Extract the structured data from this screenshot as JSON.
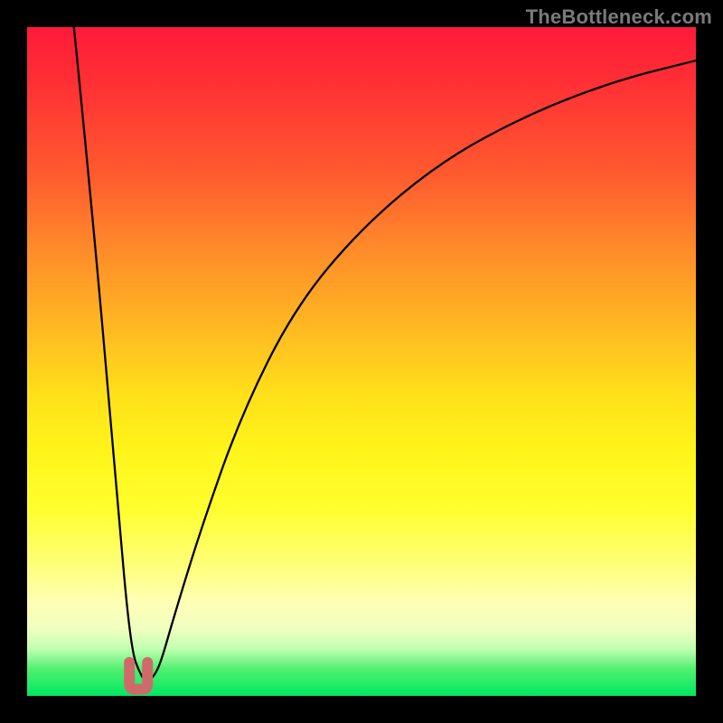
{
  "watermark": "TheBottleneck.com",
  "chart_data": {
    "type": "line",
    "title": "",
    "xlabel": "",
    "ylabel": "",
    "xlim": [
      0,
      100
    ],
    "ylim": [
      0,
      100
    ],
    "series": [
      {
        "name": "bottleneck-curve",
        "x": [
          7,
          10,
          13.5,
          15.5,
          17,
          18,
          19,
          20,
          22,
          26,
          32,
          40,
          50,
          62,
          75,
          88,
          100
        ],
        "values": [
          0,
          30,
          71,
          93,
          97,
          98,
          97,
          95,
          88,
          75,
          58,
          42,
          30,
          20,
          13,
          8,
          5
        ]
      }
    ],
    "marker": {
      "name": "valley-marker",
      "x_range": [
        15.3,
        18.0
      ],
      "y_range": [
        95,
        99
      ],
      "shape": "U",
      "color": "#d06a6a"
    },
    "grid": false,
    "legend": false,
    "background_gradient": {
      "direction": "vertical",
      "stops": [
        {
          "pos": 0.0,
          "color": "#ff1a3a"
        },
        {
          "pos": 0.22,
          "color": "#ff5a2f"
        },
        {
          "pos": 0.45,
          "color": "#ffb922"
        },
        {
          "pos": 0.72,
          "color": "#ffff2e"
        },
        {
          "pos": 0.9,
          "color": "#f0ffc0"
        },
        {
          "pos": 1.0,
          "color": "#00e860"
        }
      ]
    }
  }
}
